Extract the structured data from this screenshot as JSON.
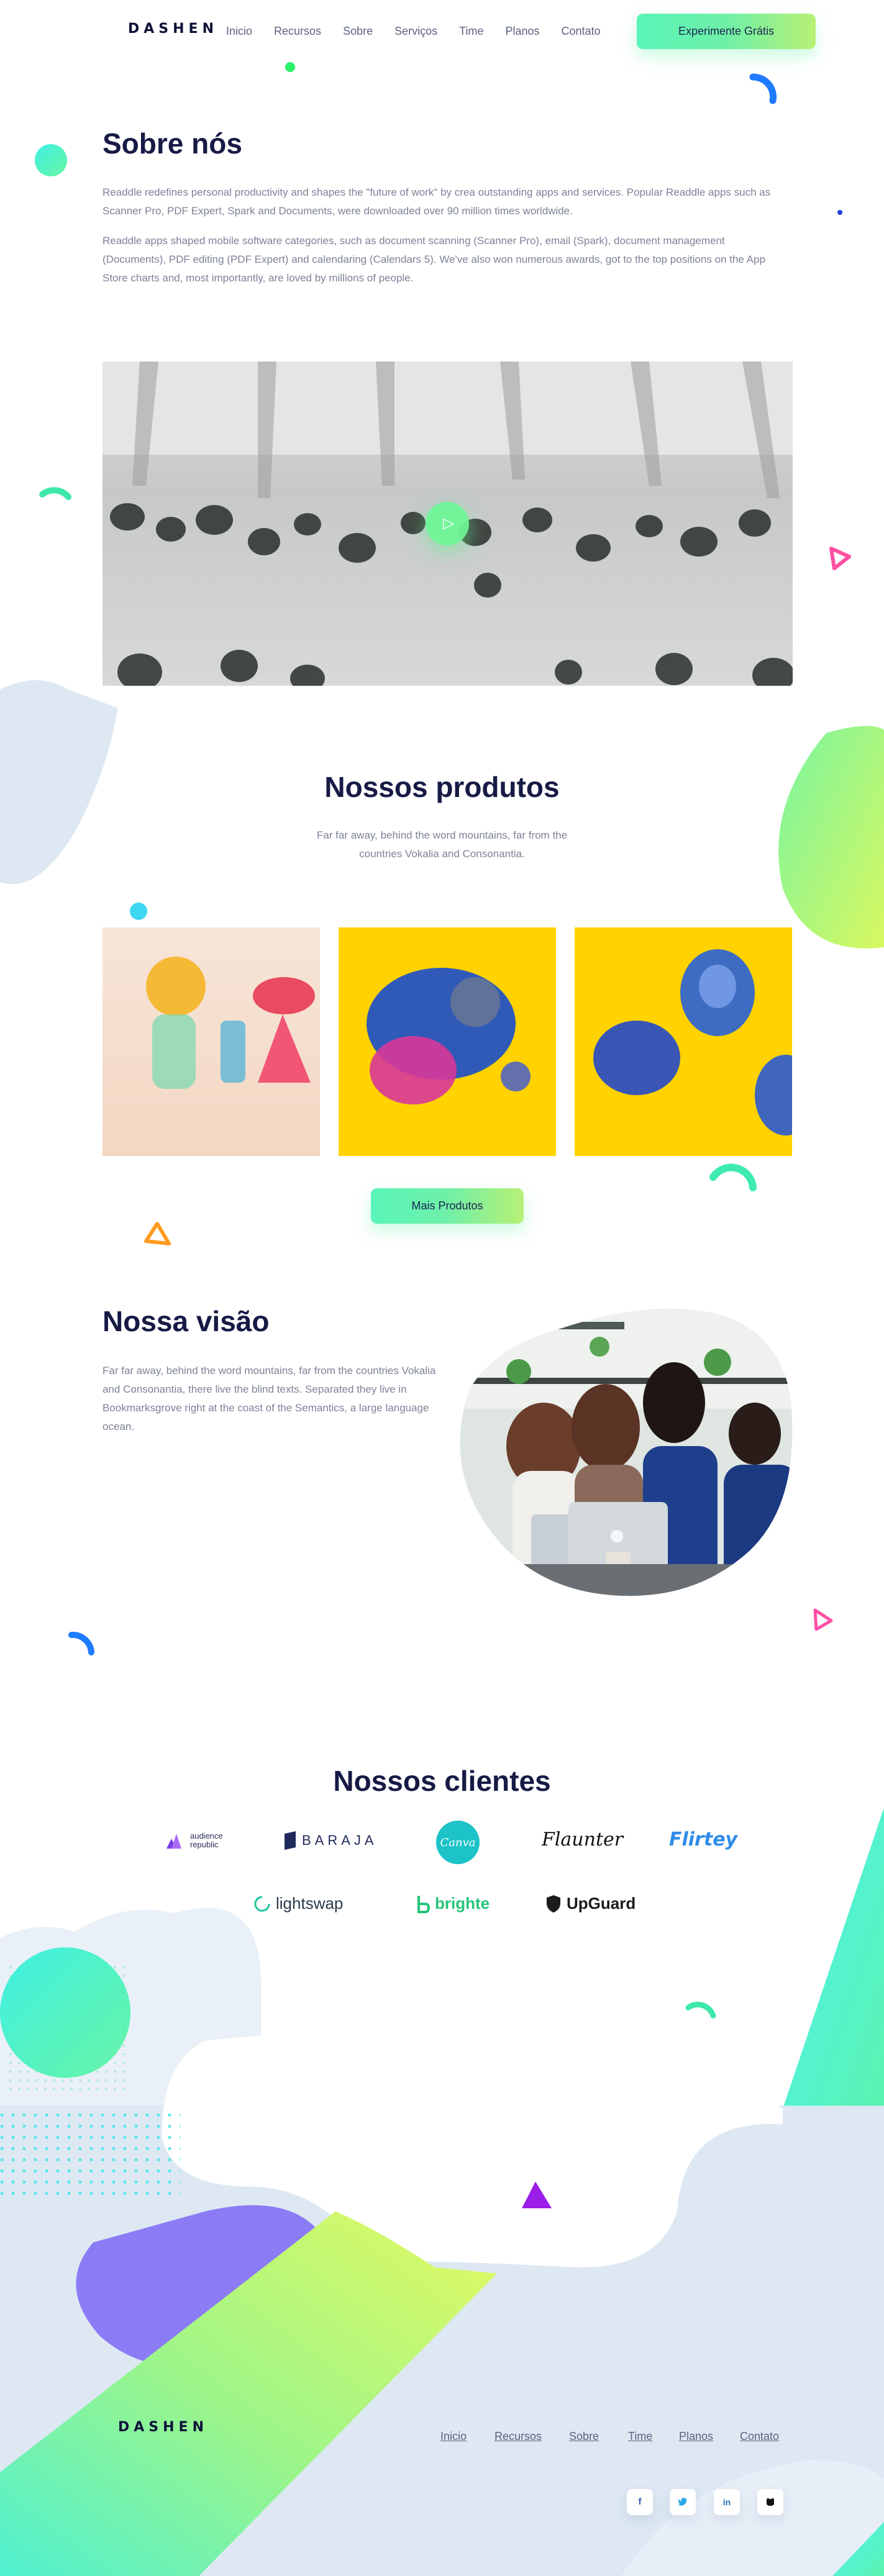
{
  "header": {
    "logo": "DASHEN",
    "nav": [
      "Inicio",
      "Recursos",
      "Sobre",
      "Serviços",
      "Time",
      "Planos",
      "Contato"
    ],
    "cta": "Experimente Grátis"
  },
  "about": {
    "title": "Sobre nós",
    "p1": "Readdle redefines personal productivity and shapes the \"future of work\" by crea outstanding apps and services. Popular Readdle apps such as Scanner Pro, PDF Expert, Spark and Documents, were downloaded over 90 million times worldwide.",
    "p2": "Readdle apps shaped mobile software categories, such as document scanning (Scanner Pro), email (Spark), document management (Documents), PDF editing (PDF Expert) and calendaring (Calendars 5). We've also won numerous awards, got to the top positions on the App Store charts and, most importantly, are loved by millions of people."
  },
  "products": {
    "title": "Nossos produtos",
    "subtitle": "Far far away, behind the word mountains, far from the countries Vokalia and Consonantia.",
    "more_button": "Mais Produtos"
  },
  "vision": {
    "title": "Nossa visão",
    "text": "Far far away, behind the word mountains, far from the countries Vokalia and Consonantia, there live the blind texts. Separated they live in Bookmarksgrove right at the coast of the Semantics, a large language ocean."
  },
  "clients": {
    "title": "Nossos clientes",
    "logos": [
      "audience republic",
      "BARAJA",
      "Canva",
      "Flaunter",
      "Flirtey",
      "lightswap",
      "brighte",
      "UpGuard"
    ]
  },
  "footer": {
    "logo": "DASHEN",
    "nav": [
      "Inicio",
      "Recursos",
      "Sobre",
      "Time",
      "Planos",
      "Contato"
    ],
    "social_icons": [
      "facebook-icon",
      "twitter-icon",
      "linkedin-icon",
      "github-icon"
    ]
  },
  "colors": {
    "accent_green": "#6ff0a8",
    "accent_lime": "#c8f56a",
    "accent_cyan": "#4ef0e0",
    "accent_purple": "#8b7cf6",
    "accent_pink": "#ff4fa3",
    "accent_orange": "#ff9a1f",
    "accent_blue": "#2a7bff",
    "title_navy": "#161a45"
  }
}
